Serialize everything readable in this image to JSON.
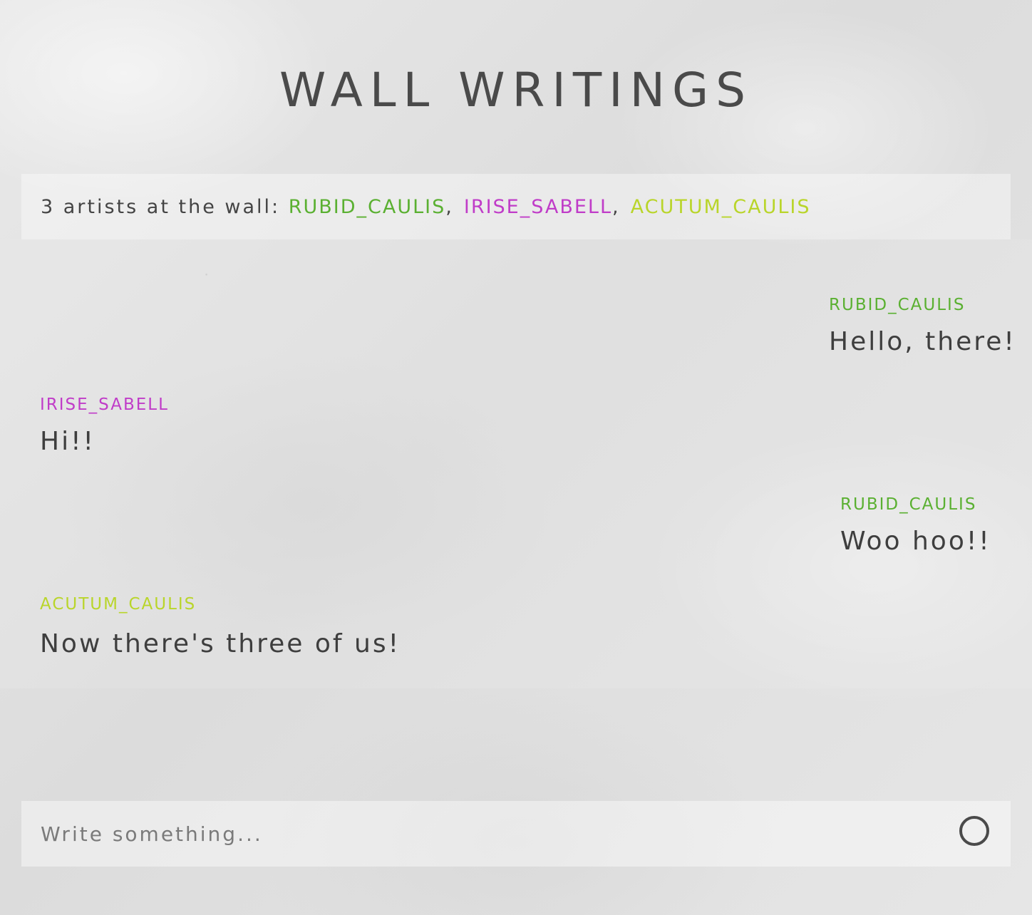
{
  "header": {
    "title": "Wall Writings"
  },
  "artists": {
    "prefix": "3 artists at the wall: ",
    "list": [
      {
        "name": "rubid_caulis",
        "color": "#5ab031"
      },
      {
        "name": "irise_sabell",
        "color": "#c03cc8"
      },
      {
        "name": "acutum_caulis",
        "color": "#b9d52a"
      }
    ],
    "separator": ","
  },
  "messages": [
    {
      "author": "rubid_caulis",
      "text": "Hello, there!",
      "align": "right",
      "color": "#5ab031"
    },
    {
      "author": "irise_sabell",
      "text": "Hi!!",
      "align": "left",
      "color": "#c03cc8"
    },
    {
      "author": "rubid_caulis",
      "text": "Woo hoo!!",
      "align": "right",
      "color": "#5ab031"
    },
    {
      "author": "acutum_caulis",
      "text": "Now there's three of us!",
      "align": "left",
      "color": "#b9d52a"
    }
  ],
  "composer": {
    "placeholder": "Write something...",
    "value": "",
    "send_icon": "circle-icon"
  }
}
